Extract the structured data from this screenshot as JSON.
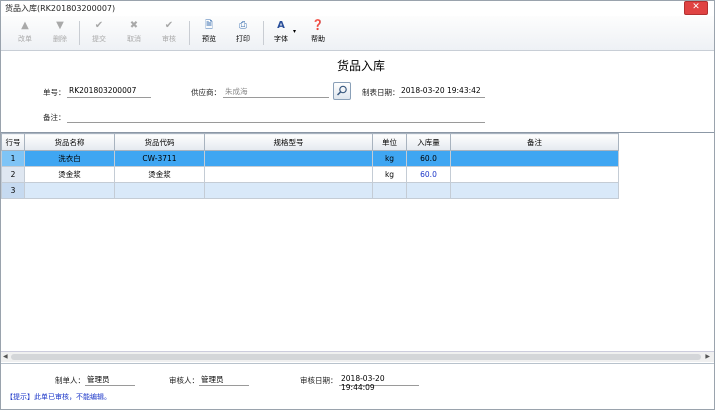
{
  "window": {
    "title": "货品入库(RK201803200007)"
  },
  "toolbar": {
    "items": [
      {
        "label": "改单",
        "icon": "arrow-up-icon",
        "enabled": false
      },
      {
        "label": "删除",
        "icon": "arrow-down-icon",
        "enabled": false
      },
      {
        "label": "提交",
        "icon": "check-icon",
        "enabled": false
      },
      {
        "label": "取消",
        "icon": "x-icon",
        "enabled": false
      },
      {
        "label": "审核",
        "icon": "check-icon",
        "enabled": false
      },
      {
        "label": "预览",
        "icon": "preview-icon",
        "enabled": true
      },
      {
        "label": "打印",
        "icon": "printer-icon",
        "enabled": true
      },
      {
        "label": "字体",
        "icon": "font-icon",
        "enabled": true
      },
      {
        "label": "帮助",
        "icon": "help-icon",
        "enabled": true
      }
    ]
  },
  "form": {
    "title": "货品入库",
    "order_no_label": "单号：",
    "order_no": "RK201803200007",
    "supplier_label": "供应商：",
    "supplier": "朱成海",
    "date_label": "制表日期：",
    "date": "2018-03-20 19:43:42",
    "remark_label": "备注：",
    "remark": ""
  },
  "table": {
    "columns": [
      "行号",
      "货品名称",
      "货品代码",
      "规格型号",
      "单位",
      "入库量",
      "备注"
    ],
    "rows": [
      {
        "no": "1",
        "name": "洗衣白",
        "code": "CW-3711",
        "spec": "",
        "unit": "kg",
        "qty": "60.0",
        "remark": ""
      },
      {
        "no": "2",
        "name": "烫金浆",
        "code": "烫金浆",
        "spec": "",
        "unit": "kg",
        "qty": "60.0",
        "remark": ""
      },
      {
        "no": "3",
        "name": "",
        "code": "",
        "spec": "",
        "unit": "",
        "qty": "",
        "remark": ""
      }
    ]
  },
  "footer": {
    "maker_label": "制单人：",
    "maker": "管理员",
    "auditor_label": "审核人：",
    "auditor": "管理员",
    "audit_date_label": "审核日期：",
    "audit_date": "2018-03-20 19:44:09",
    "tip": "【提示】此单已审核，不能编辑。"
  },
  "colors": {
    "selected_row": "#3fa6f2",
    "qty_text": "#1a35c8",
    "tip_text": "#1a35c8"
  }
}
